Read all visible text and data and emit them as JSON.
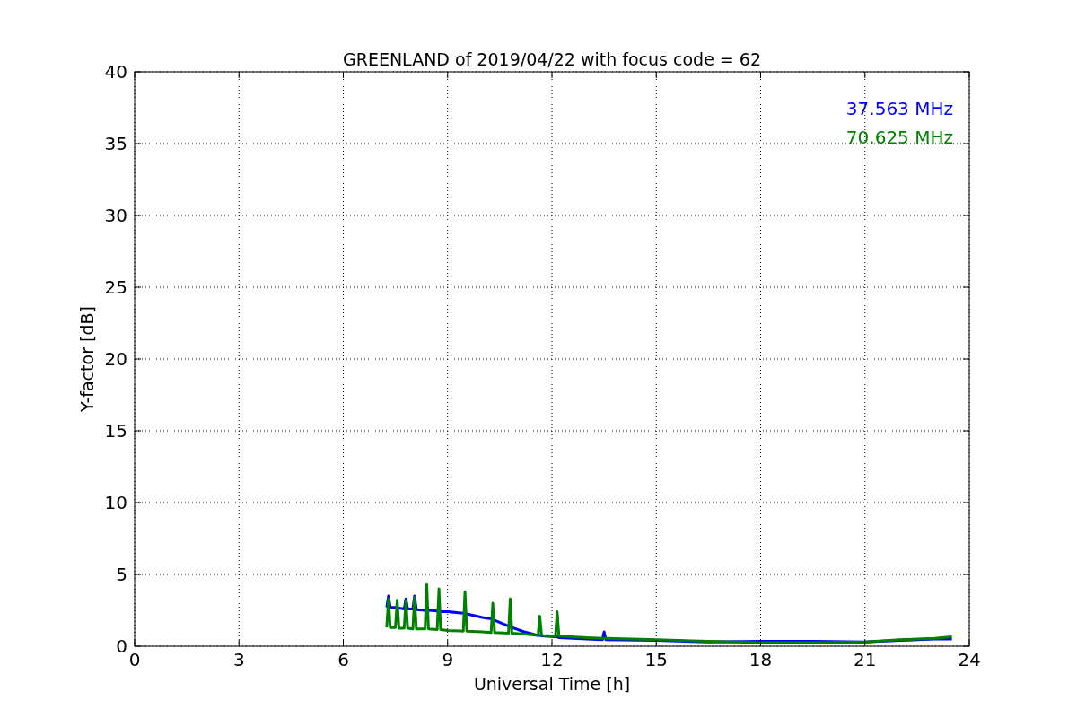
{
  "chart_data": {
    "type": "line",
    "title": "GREENLAND of 2019/04/22 with focus code = 62",
    "xlabel": "Universal Time [h]",
    "ylabel": "Y-factor [dB]",
    "xlim": [
      0,
      24
    ],
    "ylim": [
      0,
      40
    ],
    "xticks": [
      0,
      3,
      6,
      9,
      12,
      15,
      18,
      21,
      24
    ],
    "yticks": [
      0,
      5,
      10,
      15,
      20,
      25,
      30,
      35,
      40
    ],
    "grid": true,
    "x": [
      7.25,
      7.3,
      7.35,
      7.5,
      7.55,
      7.6,
      7.75,
      7.8,
      7.85,
      8.0,
      8.05,
      8.1,
      8.35,
      8.4,
      8.45,
      8.7,
      8.75,
      8.8,
      9.0,
      9.45,
      9.5,
      9.55,
      10.0,
      10.25,
      10.3,
      10.35,
      10.75,
      10.8,
      10.85,
      11.2,
      11.6,
      11.65,
      11.7,
      12.1,
      12.15,
      12.2,
      13.0,
      13.45,
      13.5,
      13.55,
      15,
      16.5,
      18,
      19.5,
      21,
      22,
      23,
      23.5
    ],
    "series": [
      {
        "name": "37.563 MHz",
        "color": "#0000ff",
        "values": [
          2.7,
          3.5,
          2.7,
          2.7,
          2.65,
          2.65,
          2.6,
          3.3,
          2.6,
          2.6,
          3.5,
          2.55,
          2.5,
          2.5,
          2.5,
          2.45,
          2.45,
          2.4,
          2.4,
          2.3,
          2.3,
          2.25,
          2.0,
          1.9,
          1.85,
          1.8,
          1.4,
          1.35,
          1.3,
          1.0,
          0.75,
          0.75,
          0.72,
          0.65,
          0.65,
          0.6,
          0.5,
          0.45,
          1.0,
          0.45,
          0.4,
          0.3,
          0.35,
          0.35,
          0.3,
          0.4,
          0.5,
          0.5
        ]
      },
      {
        "name": "70.625 MHz",
        "color": "#008000",
        "values": [
          1.3,
          3.3,
          1.3,
          1.3,
          3.2,
          1.25,
          1.25,
          3.2,
          1.25,
          1.2,
          3.4,
          1.2,
          1.2,
          4.3,
          1.2,
          1.15,
          4.0,
          1.15,
          1.1,
          1.05,
          3.8,
          1.05,
          1.0,
          0.95,
          3.0,
          0.95,
          0.9,
          3.3,
          0.9,
          0.85,
          0.75,
          2.1,
          0.75,
          0.7,
          2.4,
          0.7,
          0.6,
          0.55,
          0.55,
          0.55,
          0.45,
          0.35,
          0.25,
          0.25,
          0.3,
          0.45,
          0.55,
          0.65
        ]
      }
    ]
  }
}
